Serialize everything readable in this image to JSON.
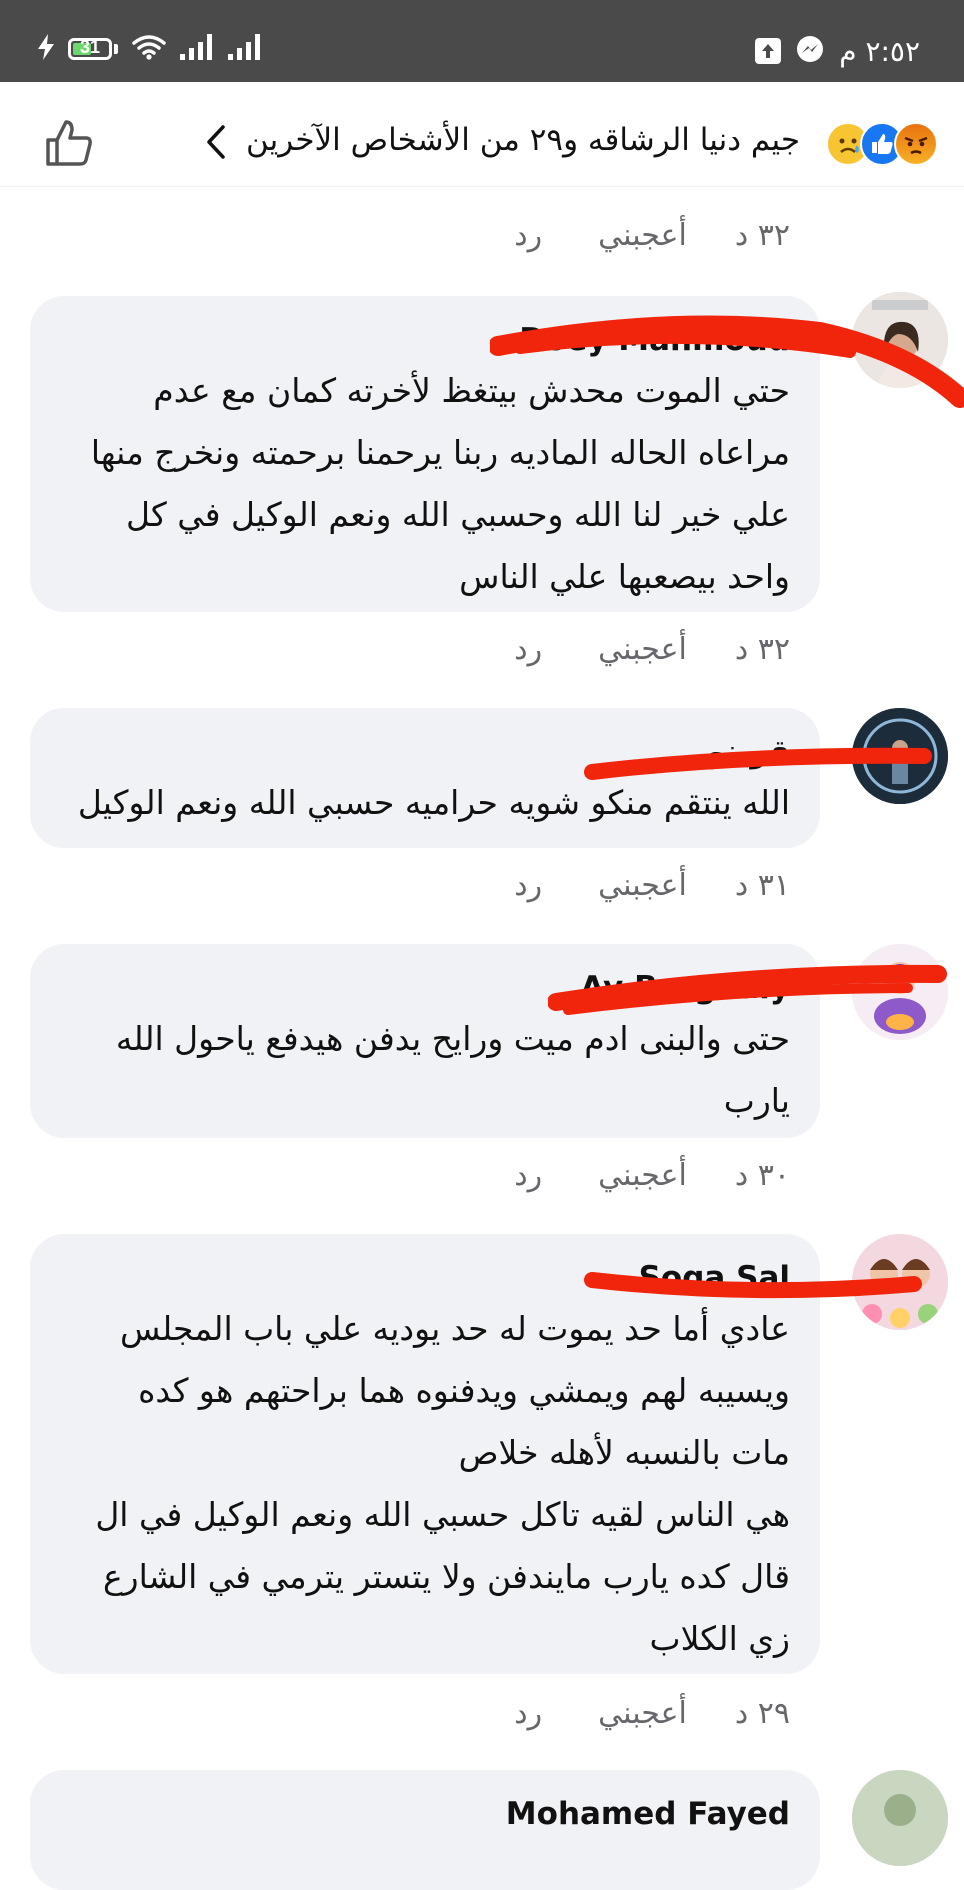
{
  "status_bar": {
    "battery": "31",
    "time": "٢:٥٢ م"
  },
  "reactions": {
    "summary": "جيم دنيا الرشاقه و٢٩ من الأشخاص الآخرين"
  },
  "actions": {
    "like": "أعجبني",
    "reply": "رد"
  },
  "top_meta": {
    "time": "٣٢ د"
  },
  "comments": [
    {
      "author": "Doey Mahmoud",
      "text": "حتي الموت محدش بيتغظ لأخرته كمان مع عدم\nمراعاه الحاله الماديه ربنا يرحمنا برحمته ونخرج منها\nعلي خير لنا الله وحسبي الله ونعم الوكيل في كل\nواحد بيصعبها علي الناس",
      "time": "٣٢ د"
    },
    {
      "author": "قرينو",
      "text": "الله ينتقم منكو شويه حراميه حسبي الله ونعم الوكيل",
      "time": "٣١ د"
    },
    {
      "author": "Ay Barghaly",
      "text": "حتى والبنى ادم ميت ورايح يدفن هيدفع ياحول الله\nيارب",
      "time": "٣٠ د"
    },
    {
      "author": "Soga Sal",
      "text": "عادي أما حد يموت له حد يوديه علي باب المجلس\nويسيبه لهم ويمشي ويدفنوه هما براحتهم هو كده\nمات بالنسبه لأهله خلاص\nهي الناس لقيه تاكل حسبي الله ونعم الوكيل في ال\nقال كده يارب مايندفن ولا يتستر يترمي في الشارع\nزي الكلاب",
      "time": "٢٩ د"
    },
    {
      "author": "Mohamed Fayed"
    }
  ],
  "colors": {
    "status_bar": "#4a4a4a",
    "bubble": "#f0f2f5",
    "meta_text": "#65676b",
    "redaction": "#f0250c"
  }
}
